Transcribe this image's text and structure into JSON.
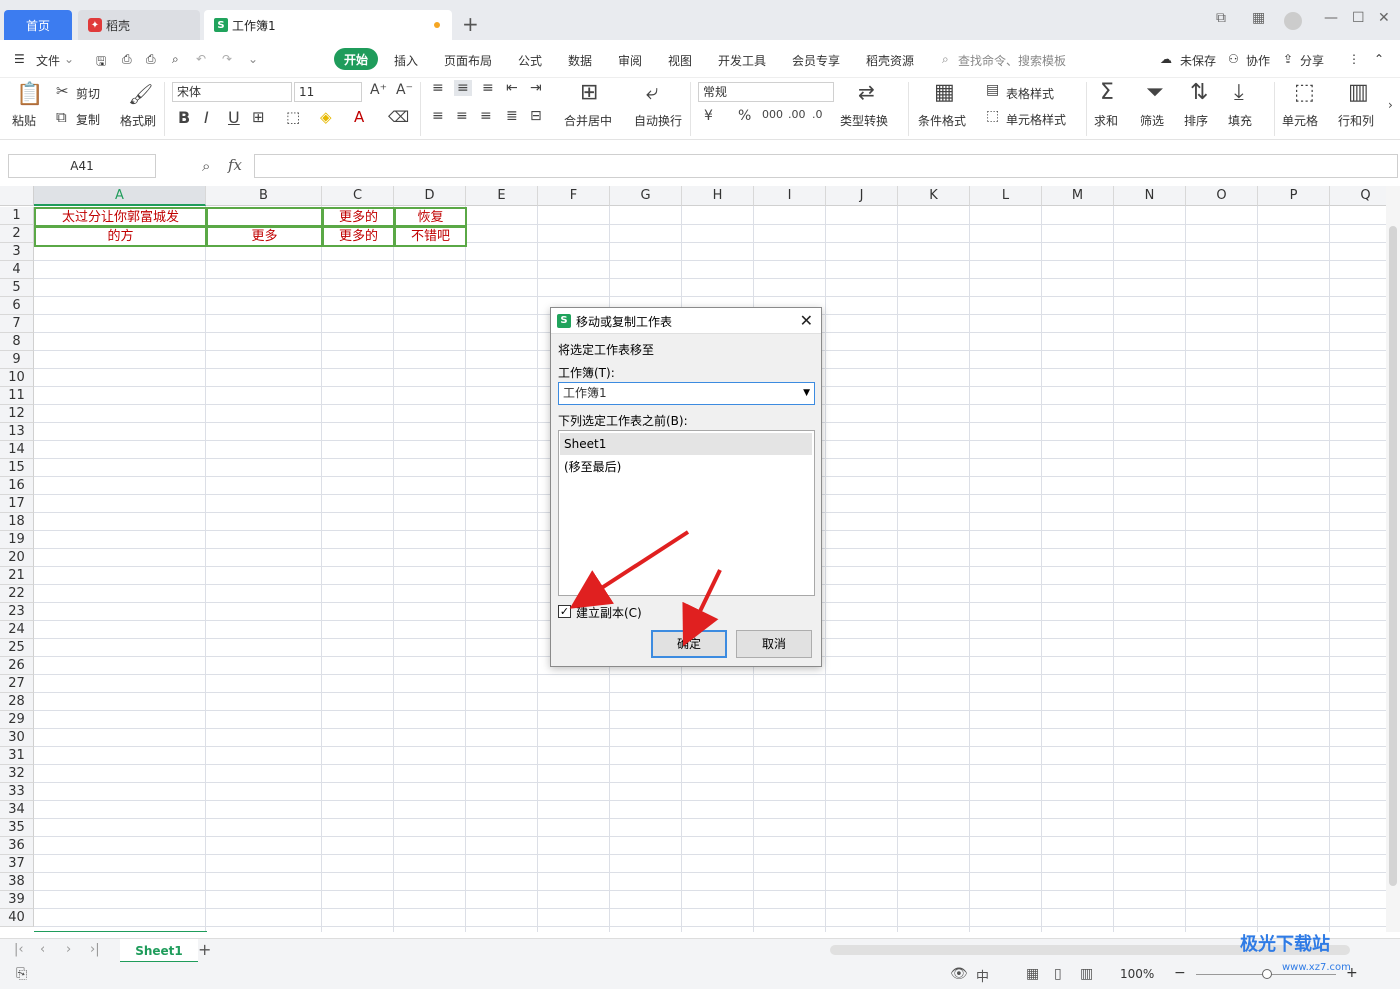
{
  "tabbar": {
    "home_label": "首页",
    "daoke_label": "稻壳",
    "book_label": "工作簿1"
  },
  "menubar": {
    "file_label": "文件",
    "items": [
      "开始",
      "插入",
      "页面布局",
      "公式",
      "数据",
      "审阅",
      "视图",
      "开发工具",
      "会员专享",
      "稻壳资源"
    ],
    "search_placeholder": "查找命令、搜索模板",
    "unsaved_label": "未保存",
    "collab_label": "协作",
    "share_label": "分享"
  },
  "ribbon": {
    "paste_label": "粘贴",
    "cut_label": "剪切",
    "copy_label": "复制",
    "format_painter_label": "格式刷",
    "font_name": "宋体",
    "font_size": "11",
    "merge_label": "合并居中",
    "wrap_label": "自动换行",
    "number_format": "常规",
    "type_convert_label": "类型转换",
    "cond_format_label": "条件格式",
    "table_style_label": "表格样式",
    "cell_style_label": "单元格样式",
    "sum_label": "求和",
    "filter_label": "筛选",
    "sort_label": "排序",
    "fill_label": "填充",
    "cell_label": "单元格",
    "rowcol_label": "行和列"
  },
  "formulabar": {
    "namebox": "A41",
    "fx": "fx"
  },
  "grid": {
    "columns": [
      "A",
      "B",
      "C",
      "D",
      "E",
      "F",
      "G",
      "H",
      "I",
      "J",
      "K",
      "L",
      "M",
      "N",
      "O",
      "P",
      "Q"
    ],
    "rows": [
      "1",
      "2",
      "3",
      "4",
      "5",
      "6",
      "7",
      "8",
      "9",
      "10",
      "11",
      "12",
      "13",
      "14",
      "15",
      "16",
      "17",
      "18",
      "19",
      "20",
      "21",
      "22",
      "23",
      "24",
      "25",
      "26",
      "27",
      "28",
      "29",
      "30",
      "31",
      "32",
      "33",
      "34",
      "35",
      "36",
      "37",
      "38",
      "39",
      "40"
    ],
    "cells": {
      "A1": "太过分让你郭富城发",
      "C1": "更多的",
      "D1": "恢复",
      "A2": "的方",
      "B2": "更多",
      "C2": "更多的",
      "D2": "不错吧"
    }
  },
  "sheetbar": {
    "sheet_name": "Sheet1"
  },
  "statusbar": {
    "zoom": "100%"
  },
  "dialog": {
    "title": "移动或复制工作表",
    "move_to_label": "将选定工作表移至",
    "workbook_label": "工作簿(T):",
    "workbook_value": "工作簿1",
    "before_label": "下列选定工作表之前(B):",
    "list_items": [
      "Sheet1",
      "(移至最后)"
    ],
    "copy_checkbox_label": "建立副本(C)",
    "copy_checked": true,
    "ok_label": "确定",
    "cancel_label": "取消"
  },
  "watermark": {
    "text": "极光下载站",
    "url": "www.xz7.com"
  },
  "colors": {
    "accent_green": "#1f9c5b",
    "home_tab_blue": "#3c7cf0",
    "cell_text_red": "#c00000",
    "arrow_red": "#e02020"
  }
}
